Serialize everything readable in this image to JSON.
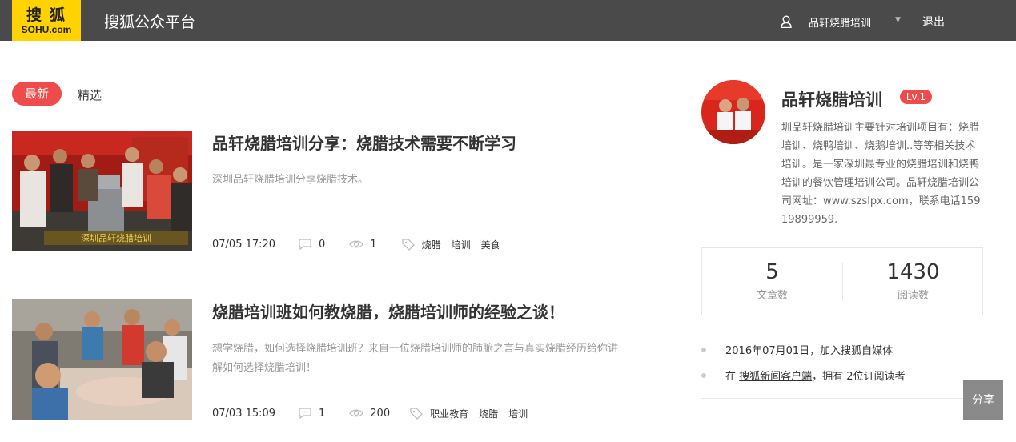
{
  "header": {
    "logo_top": "搜狐",
    "logo_bottom": "SOHU.com",
    "platform_title": "搜狐公众平台",
    "user_name": "品轩烧腊培训",
    "logout": "退出"
  },
  "tabs": {
    "latest": "最新",
    "featured": "精选"
  },
  "articles": [
    {
      "title": "品轩烧腊培训分享：烧腊技术需要不断学习",
      "desc": "深圳品轩烧腊培训分享烧腊技术。",
      "time": "07/05 17:20",
      "comments": "0",
      "views": "1",
      "tags": [
        "烧腊",
        "培训",
        "美食"
      ]
    },
    {
      "title": "烧腊培训班如何教烧腊，烧腊培训师的经验之谈！",
      "desc": "想学烧腊，如何选择烧腊培训班？来自一位烧腊培训师的肺腑之言与真实烧腊经历给你讲解如何选择烧腊培训！",
      "time": "07/03 15:09",
      "comments": "1",
      "views": "200",
      "tags": [
        "职业教育",
        "烧腊",
        "培训"
      ]
    }
  ],
  "sidebar": {
    "name": "品轩烧腊培训",
    "level": "Lv.1",
    "desc": "圳品轩烧腊培训主要针对培训项目有：烧腊培训、烧鸭培训、烧鹅培训..等等相关技术培训。是一家深圳最专业的烧腊培训和烧鸭培训的餐饮管理培训公司。品轩烧腊培训公司网址：www.szslpx.com，联系电话15919899959.",
    "articles_count": "5",
    "articles_label": "文章数",
    "reads_count": "1430",
    "reads_label": "阅读数",
    "joined": "2016年07月01日，加入搜狐自媒体",
    "client_prefix": "在",
    "client_link": "搜狐新闻客户端",
    "client_suffix": "，拥有 2位订阅读者"
  },
  "share": "分享",
  "colors": {
    "accent": "#ef4b4b",
    "topbar": "#4a4a4a",
    "logo": "#ffd200"
  }
}
